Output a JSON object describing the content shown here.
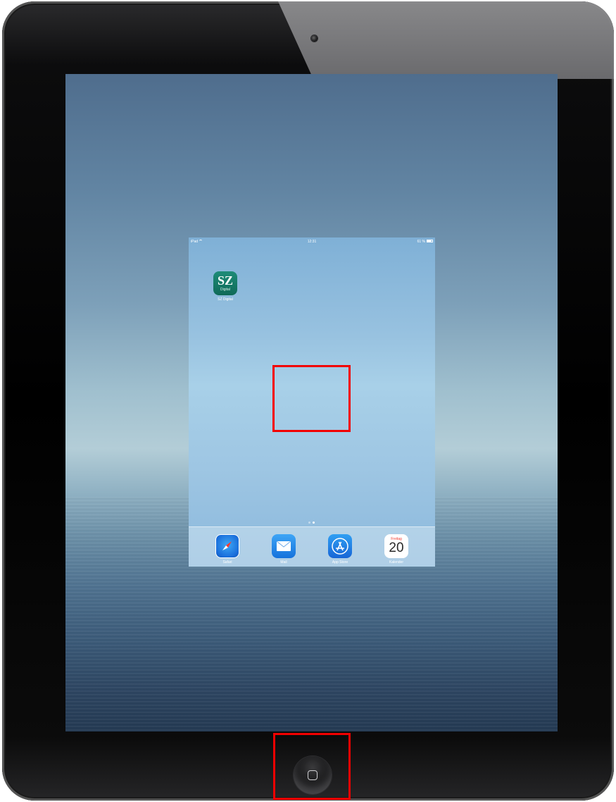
{
  "device": {
    "model": "iPad"
  },
  "status_bar": {
    "carrier": "iPad",
    "time": "12:31",
    "battery_text": "61 %"
  },
  "home_screen": {
    "apps": [
      {
        "name": "SZ Digital",
        "icon": "sz-digital-icon",
        "icon_text": "SZ",
        "icon_subtext": "Digital"
      }
    ],
    "page_indicator": {
      "current_page": 2,
      "total_pages": 2
    }
  },
  "dock": {
    "apps": [
      {
        "name": "Safari",
        "icon": "safari-icon"
      },
      {
        "name": "Mail",
        "icon": "mail-icon"
      },
      {
        "name": "App Store",
        "icon": "app-store-icon"
      },
      {
        "name": "Kalender",
        "icon": "calendar-icon",
        "day_label": "Freitag",
        "date": "20"
      }
    ]
  },
  "annotations": {
    "highlight_color": "#f20000",
    "targets": [
      "home-screen-center-area",
      "home-button"
    ]
  },
  "colors": {
    "device_body": "#000000",
    "dock_tint": "#dcebf5",
    "sz_green": "#1a7f6c"
  }
}
